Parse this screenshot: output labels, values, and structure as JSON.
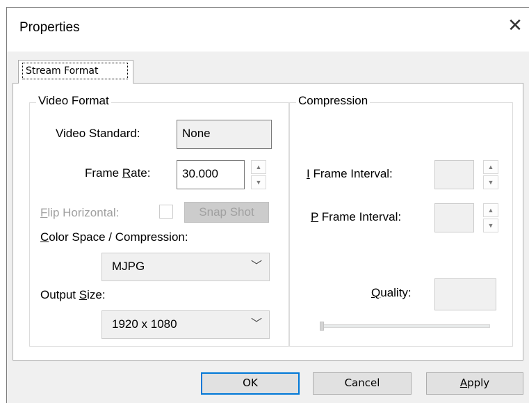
{
  "window": {
    "title": "Properties",
    "close_glyph": "✕"
  },
  "tabs": [
    {
      "label": "Stream Format"
    }
  ],
  "video_format": {
    "group_label": "Video Format",
    "video_standard_label": "Video Standard:",
    "video_standard_value": "None",
    "frame_rate_label_pre": "Frame ",
    "frame_rate_label_ul": "R",
    "frame_rate_label_post": "ate:",
    "frame_rate_value": "30.000",
    "flip_label_ul": "F",
    "flip_label_post": "lip Horizontal:",
    "snapshot_label": "Snap Shot",
    "color_space_label_ul": "C",
    "color_space_label_post": "olor Space / Compression:",
    "color_space_value": "MJPG",
    "output_size_label_pre": "Output ",
    "output_size_label_ul": "S",
    "output_size_label_post": "ize:",
    "output_size_value": "1920 x 1080"
  },
  "compression": {
    "group_label": "Compression",
    "i_frame_label_ul": "I",
    "i_frame_label_post": " Frame Interval:",
    "p_frame_label_ul": "P",
    "p_frame_label_post": " Frame Interval:",
    "quality_label_ul": "Q",
    "quality_label_post": "uality:"
  },
  "buttons": {
    "ok": "OK",
    "cancel": "Cancel",
    "apply_ul": "A",
    "apply_post": "pply"
  },
  "icons": {
    "spin_up": "▲",
    "spin_down": "▼",
    "chevron_down": "﹀"
  },
  "colors": {
    "accent": "#0078d7",
    "dialog_bg": "#f0f0f0",
    "disabled_text": "#a0a0a0"
  }
}
